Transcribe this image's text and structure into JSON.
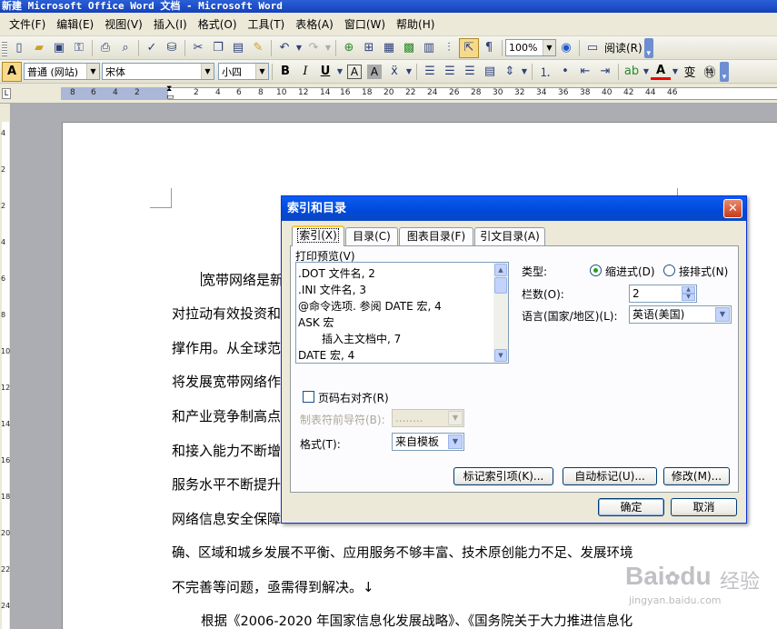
{
  "window": {
    "title": "新建 Microsoft Office Word 文档 - Microsoft Word"
  },
  "menu": [
    "文件(F)",
    "编辑(E)",
    "视图(V)",
    "插入(I)",
    "格式(O)",
    "工具(T)",
    "表格(A)",
    "窗口(W)",
    "帮助(H)"
  ],
  "toolbar1": {
    "zoom": "100%",
    "read_label": "阅读(R)"
  },
  "toolbar2": {
    "style": "普通 (网站)",
    "font": "宋体",
    "size": "小四",
    "bold": "B",
    "italic": "I",
    "underline": "U",
    "char_border": "A",
    "char_shading": "A",
    "font_color": "A",
    "ext_char": "变"
  },
  "ruler": {
    "numbers": [
      "8",
      "6",
      "4",
      "2",
      "2",
      "4",
      "6",
      "8",
      "10",
      "12",
      "14",
      "16",
      "18",
      "20",
      "22",
      "24",
      "26",
      "28",
      "30",
      "32",
      "34",
      "36",
      "38",
      "40",
      "42",
      "44",
      "46"
    ],
    "vnumbers": [
      "4",
      "2",
      "2",
      "4",
      "6",
      "8",
      "10",
      "12",
      "14",
      "16",
      "18",
      "20",
      "22",
      "24"
    ]
  },
  "document": {
    "lines": [
      "宽带网络是新",
      "对拉动有效投资和",
      "撑作用。从全球范",
      "将发展宽带网络作",
      "和产业竞争制高点",
      "和接入能力不断增",
      "服务水平不断提升",
      "网络信息安全保障",
      "确、区域和城乡发展不平衡、应用服务不够丰富、技术原创能力不足、发展环境",
      "不完善等问题，亟需得到解决。↓",
      "根据《2006-2020 年国家信息化发展战略》、《国务院关于大力推进信息化"
    ]
  },
  "dialog": {
    "title": "索引和目录",
    "tabs": [
      "索引(X)",
      "目录(C)",
      "图表目录(F)",
      "引文目录(A)"
    ],
    "preview_label": "打印预览(V)",
    "preview_lines": [
      ".DOT 文件名, 2",
      ".INI 文件名, 3",
      "@命令选项. 参阅 DATE 宏, 4",
      "ASK 宏",
      "插入主文档中, 7",
      "DATE 宏, 4"
    ],
    "type_label": "类型:",
    "type_indent": "缩进式(D)",
    "type_runin": "接排式(N)",
    "columns_label": "栏数(O):",
    "columns_value": "2",
    "language_label": "语言(国家/地区)(L):",
    "language_value": "英语(美国)",
    "right_align_label": "页码右对齐(R)",
    "tab_leader_label": "制表符前导符(B):",
    "tab_leader_value": "........",
    "format_label": "格式(T):",
    "format_value": "来自模板",
    "mark_entry": "标记索引项(K)...",
    "auto_mark": "自动标记(U)...",
    "modify": "修改(M)...",
    "ok": "确定",
    "cancel": "取消"
  },
  "watermark": {
    "brand": "Bai",
    "brand2": "du",
    "suffix": "经验",
    "url": "jingyan.baidu.com"
  }
}
